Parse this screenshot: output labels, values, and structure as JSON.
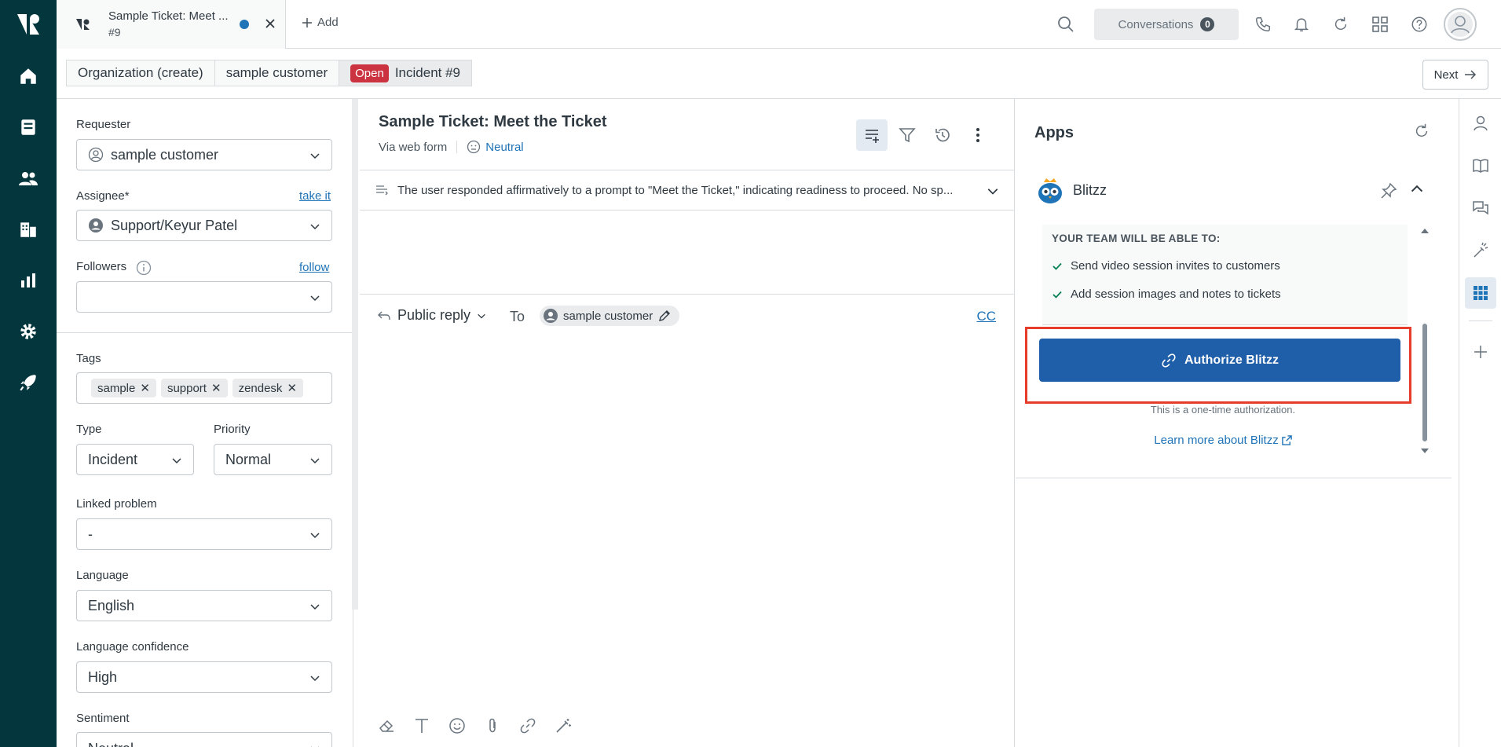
{
  "colors": {
    "nav_bg": "#03363d",
    "accent": "#1f73b7",
    "open_status": "#cc3340",
    "authorize_button": "#1f5ea8",
    "highlight_outline": "#e53d2a"
  },
  "topbar": {
    "tab": {
      "title": "Sample Ticket: Meet ...",
      "subtitle": "#9"
    },
    "add_label": "Add",
    "conversations_label": "Conversations",
    "conversations_count": "0"
  },
  "breadcrumb": {
    "items": [
      "Organization (create)",
      "sample customer"
    ],
    "status": "Open",
    "current": "Incident #9",
    "next_label": "Next"
  },
  "properties": {
    "requester": {
      "label": "Requester",
      "value": "sample customer"
    },
    "assignee": {
      "label": "Assignee*",
      "link": "take it",
      "value": "Support/Keyur Patel"
    },
    "followers": {
      "label": "Followers",
      "link": "follow",
      "value": ""
    },
    "tags": {
      "label": "Tags",
      "items": [
        "sample",
        "support",
        "zendesk"
      ]
    },
    "type": {
      "label": "Type",
      "value": "Incident"
    },
    "priority": {
      "label": "Priority",
      "value": "Normal"
    },
    "linked_problem": {
      "label": "Linked problem",
      "value": "-"
    },
    "language": {
      "label": "Language",
      "value": "English"
    },
    "language_confidence": {
      "label": "Language confidence",
      "value": "High"
    },
    "sentiment": {
      "label": "Sentiment",
      "value": "Neutral"
    }
  },
  "ticket": {
    "title": "Sample Ticket: Meet the Ticket",
    "via": "Via web form",
    "sentiment": "Neutral",
    "summary": "The user responded affirmatively to a prompt to \"Meet the Ticket,\" indicating readiness to proceed. No sp...",
    "reply_type": "Public reply",
    "to_label": "To",
    "recipient": "sample customer",
    "cc_label": "CC"
  },
  "apps": {
    "title": "Apps",
    "app_name": "Blitzz",
    "permissions_heading": "YOUR TEAM WILL BE ABLE TO:",
    "permissions": [
      "Send video session invites to customers",
      "Add session images and notes to tickets"
    ],
    "authorize_label": "Authorize Blitzz",
    "authorize_note": "This is a one-time authorization.",
    "learn_more": "Learn more about Blitzz"
  }
}
